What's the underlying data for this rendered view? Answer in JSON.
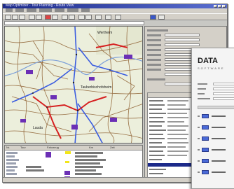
{
  "window": {
    "title": "Map Optimizer - Tour Planning - Route View"
  },
  "map": {
    "labels": [
      "Wertheim",
      "Tauberbischofsheim",
      "Lauda"
    ]
  },
  "colors": {
    "route_blue": "#3a5ce0",
    "route_red": "#d62020",
    "region_purple": "#6b2fb5",
    "road_brown": "#8a5a2a",
    "highlight_yellow": "#f2e61a"
  },
  "list": {
    "columns": [
      "Nr.",
      "Tour",
      "Fahrzeug",
      "Km",
      "Zeit"
    ]
  },
  "detail": {
    "fields_count_label": ""
  },
  "dialog": {
    "logo_text": "DATA",
    "logo_sub": "SOFTWARE"
  }
}
